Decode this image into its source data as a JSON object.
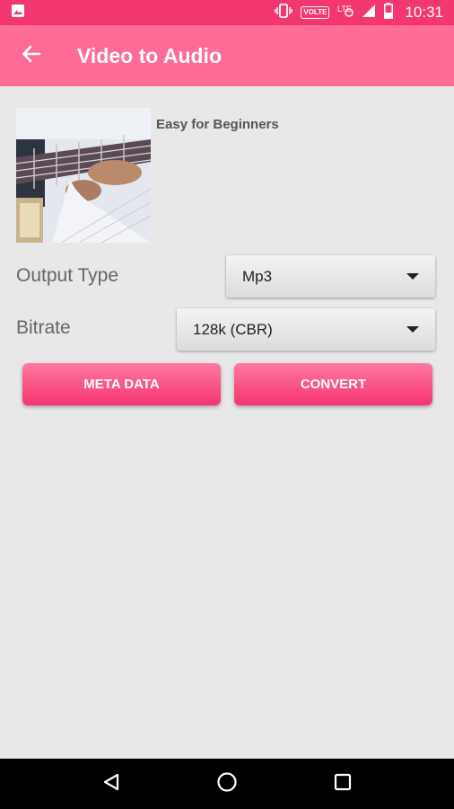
{
  "status_bar": {
    "time": "10:31",
    "volte": "VOLTE",
    "icons": [
      "image-icon",
      "vibrate-icon",
      "volte-icon",
      "data-saver-icon",
      "signal-icon",
      "battery-icon"
    ]
  },
  "app_bar": {
    "title": "Video to Audio",
    "back_icon": "arrow-back-icon",
    "background": "#fe6b95"
  },
  "video": {
    "title": "Easy for Beginners",
    "thumbnail": "guitar-video-thumbnail"
  },
  "output_type": {
    "label": "Output Type",
    "selected": "Mp3"
  },
  "bitrate": {
    "label": "Bitrate",
    "selected": "128k (CBR)"
  },
  "buttons": {
    "meta_data": "META DATA",
    "convert": "CONVERT"
  },
  "nav_bar": {
    "icons": [
      "back-triangle-icon",
      "home-circle-icon",
      "recents-square-icon"
    ]
  },
  "colors": {
    "status_bar": "#f2386f",
    "app_bar": "#fe6b95",
    "button": "#f5346f",
    "background": "#e8e8e8"
  }
}
